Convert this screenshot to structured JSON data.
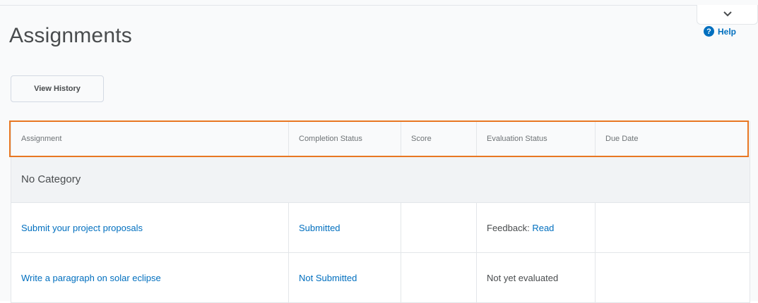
{
  "page": {
    "title": "Assignments"
  },
  "help": {
    "label": "Help",
    "icon": "help-circle-icon"
  },
  "toolbar": {
    "view_history_label": "View History"
  },
  "table": {
    "columns": [
      "Assignment",
      "Completion Status",
      "Score",
      "Evaluation Status",
      "Due Date"
    ],
    "category": "No Category",
    "rows": [
      {
        "assignment": "Submit your project proposals",
        "completion": "Submitted",
        "score": "",
        "evaluation_prefix": "Feedback: ",
        "evaluation_link": "Read",
        "due_date": ""
      },
      {
        "assignment": "Write a paragraph on solar eclipse",
        "completion": "Not Submitted",
        "score": "",
        "evaluation_prefix": "Not yet evaluated",
        "evaluation_link": "",
        "due_date": ""
      }
    ]
  },
  "colors": {
    "link": "#006fbf",
    "highlight": "#e87722"
  }
}
